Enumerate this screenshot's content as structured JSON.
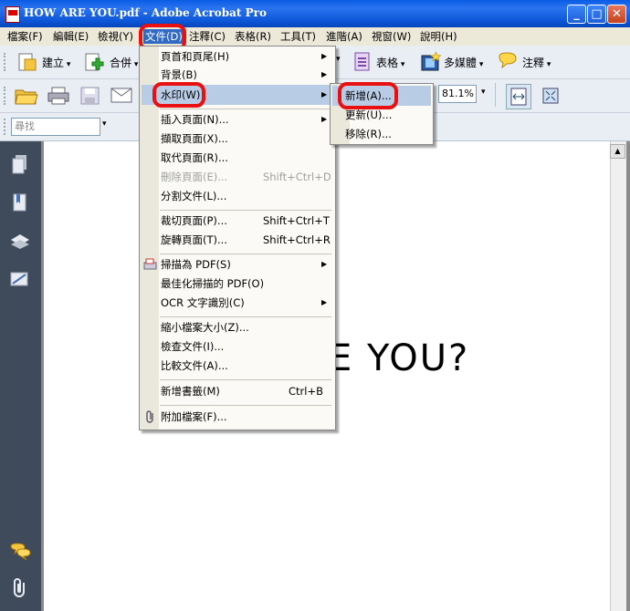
{
  "window": {
    "title": "HOW ARE YOU.pdf - Adobe Acrobat Pro",
    "minimize": "_",
    "maximize": "□",
    "close": "✕"
  },
  "menubar": {
    "items": [
      "檔案(F)",
      "編輯(E)",
      "檢視(Y)",
      "文件(D)",
      "注釋(C)",
      "表格(R)",
      "工具(T)",
      "進階(A)",
      "視窗(W)",
      "說明(H)"
    ],
    "active": "文件(D)"
  },
  "toolbar1": {
    "create": "建立",
    "combine": "合併",
    "forms": "表格",
    "multimedia": "多媒體",
    "comment": "注釋"
  },
  "toolbar2": {
    "zoom": "81.1%"
  },
  "toolbar3": {
    "search_placeholder": "尋找"
  },
  "document_menu": {
    "items": [
      {
        "label": "頁首和頁尾(H)",
        "shortcut": "",
        "submenu": true,
        "disabled": false
      },
      {
        "label": "背景(B)",
        "shortcut": "",
        "submenu": true,
        "disabled": false
      },
      {
        "label": "水印(W)",
        "shortcut": "",
        "submenu": true,
        "disabled": false,
        "highlighted": true
      },
      {
        "label": "插入頁面(N)...",
        "shortcut": "",
        "submenu": true,
        "disabled": false
      },
      {
        "label": "擷取頁面(X)...",
        "shortcut": "",
        "submenu": false,
        "disabled": false
      },
      {
        "label": "取代頁面(R)...",
        "shortcut": "",
        "submenu": false,
        "disabled": false
      },
      {
        "label": "刪除頁面(E)...",
        "shortcut": "Shift+Ctrl+D",
        "submenu": false,
        "disabled": true
      },
      {
        "label": "分割文件(L)...",
        "shortcut": "",
        "submenu": false,
        "disabled": false
      },
      {
        "label": "裁切頁面(P)...",
        "shortcut": "Shift+Ctrl+T",
        "submenu": false,
        "disabled": false
      },
      {
        "label": "旋轉頁面(T)...",
        "shortcut": "Shift+Ctrl+R",
        "submenu": false,
        "disabled": false
      },
      {
        "label": "掃描為 PDF(S)",
        "shortcut": "",
        "submenu": true,
        "disabled": false
      },
      {
        "label": "最佳化掃描的 PDF(O)",
        "shortcut": "",
        "submenu": false,
        "disabled": false
      },
      {
        "label": "OCR 文字識別(C)",
        "shortcut": "",
        "submenu": true,
        "disabled": false
      },
      {
        "label": "縮小檔案大小(Z)...",
        "shortcut": "",
        "submenu": false,
        "disabled": false
      },
      {
        "label": "檢查文件(I)...",
        "shortcut": "",
        "submenu": false,
        "disabled": false
      },
      {
        "label": "比較文件(A)...",
        "shortcut": "",
        "submenu": false,
        "disabled": false
      },
      {
        "label": "新增書籤(M)",
        "shortcut": "Ctrl+B",
        "submenu": false,
        "disabled": false
      },
      {
        "label": "附加檔案(F)...",
        "shortcut": "",
        "submenu": false,
        "disabled": false
      }
    ]
  },
  "watermark_submenu": {
    "items": [
      "新增(A)...",
      "更新(U)...",
      "移除(R)..."
    ]
  },
  "page": {
    "visible_text": "E YOU?"
  },
  "colors": {
    "titlebar": "#0a54d6",
    "menubar": "#ece9d8",
    "highlight": "#b9cce6",
    "annotation_ring": "#e81010",
    "leftnav": "#3f4a5a"
  }
}
